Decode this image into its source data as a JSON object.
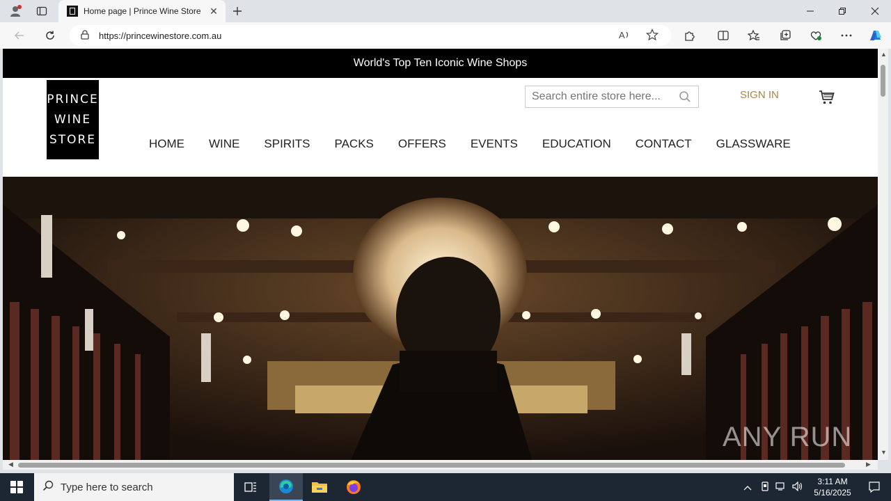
{
  "browser": {
    "tab_title": "Home page | Prince Wine Store",
    "url": "https://princewinestore.com.au"
  },
  "site": {
    "promo_text": "World's Top Ten Iconic Wine Shops",
    "logo_lines": [
      "PRINCE",
      "WINE",
      "STORE"
    ],
    "search_placeholder": "Search entire store here...",
    "sign_in": "SIGN IN",
    "menu": [
      "HOME",
      "WINE",
      "SPIRITS",
      "PACKS",
      "OFFERS",
      "EVENTS",
      "EDUCATION",
      "CONTACT",
      "GLASSWARE"
    ],
    "watermark": "ANY RUN"
  },
  "taskbar": {
    "search_placeholder": "Type here to search",
    "time": "3:11 AM",
    "date": "5/16/2025"
  },
  "colors": {
    "accent_signin": "#a8854a",
    "promo_bg": "#000000",
    "taskbar_bg": "#1d2733"
  },
  "icons": [
    "profile-icon",
    "tab-actions-icon",
    "new-tab-icon",
    "back-icon",
    "refresh-icon",
    "lock-icon",
    "read-aloud-icon",
    "favorite-star-icon",
    "extensions-icon",
    "split-screen-icon",
    "favorites-icon",
    "collections-icon",
    "browser-essentials-icon",
    "more-icon",
    "copilot-icon",
    "search-icon",
    "cart-icon",
    "windows-start-icon",
    "task-view-icon",
    "edge-icon",
    "file-explorer-icon",
    "firefox-icon"
  ]
}
